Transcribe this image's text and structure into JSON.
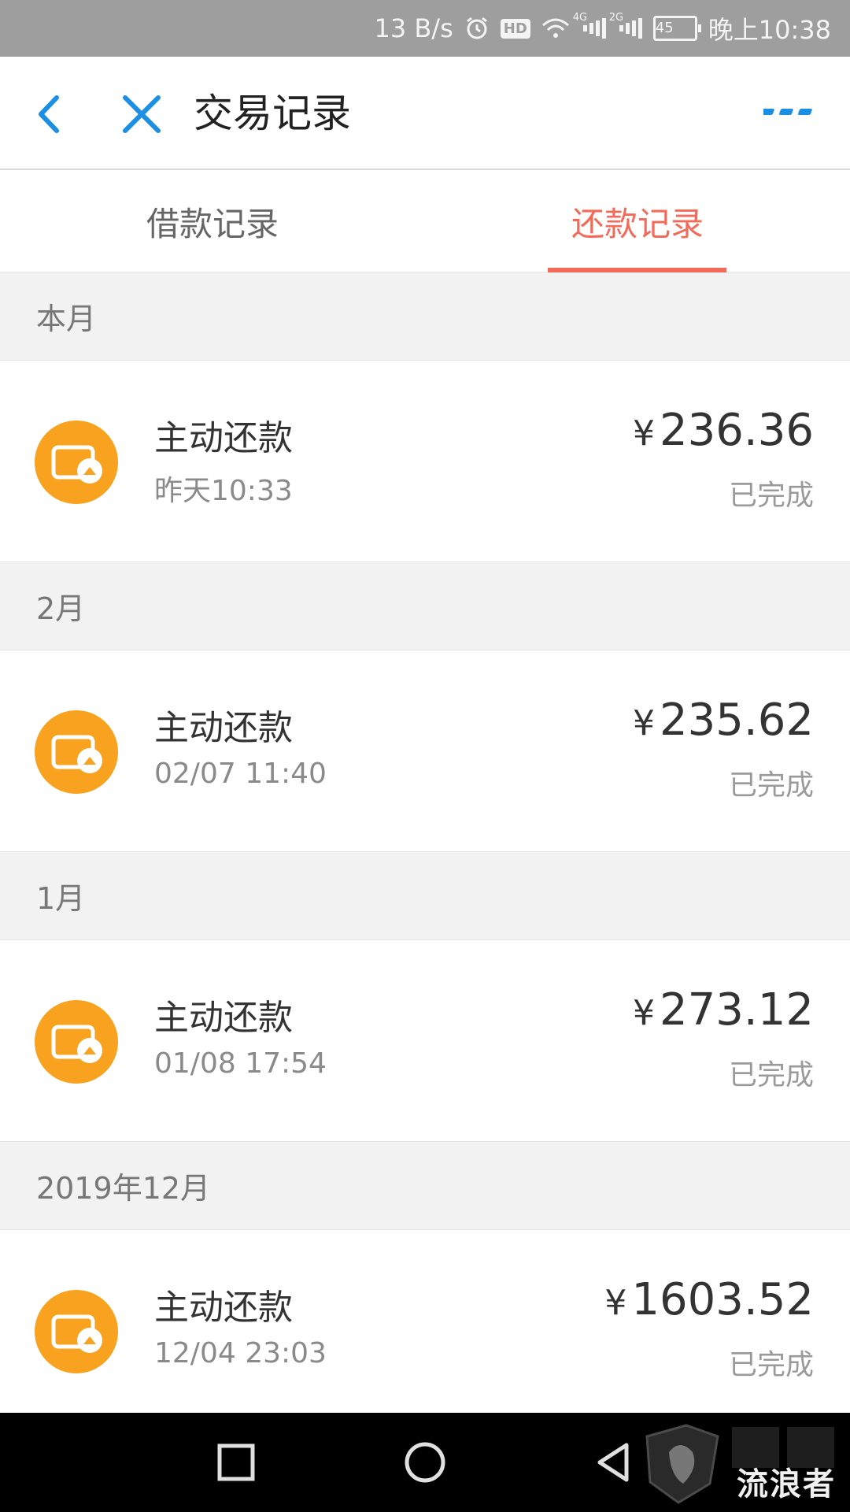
{
  "status_bar": {
    "speed": "13 B/s",
    "hd": "HD",
    "net_4g": "4G",
    "net_2g": "2G",
    "battery": "45",
    "time": "晚上10:38",
    "icons": [
      "alarm-icon",
      "hd-icon",
      "wifi-icon",
      "signal-icon",
      "battery-icon"
    ]
  },
  "header": {
    "title": "交易记录",
    "accent_color": "#1a8fe3"
  },
  "tabs": [
    {
      "label": "借款记录",
      "active": false
    },
    {
      "label": "还款记录",
      "active": true
    }
  ],
  "active_color": "#f26a5a",
  "sections": [
    {
      "month": "本月",
      "records": [
        {
          "title": "主动还款",
          "time": "昨天10:33",
          "currency": "¥",
          "amount": "236.36",
          "status": "已完成"
        }
      ]
    },
    {
      "month": "2月",
      "records": [
        {
          "title": "主动还款",
          "time": "02/07 11:40",
          "currency": "¥",
          "amount": "235.62",
          "status": "已完成"
        }
      ]
    },
    {
      "month": "1月",
      "records": [
        {
          "title": "主动还款",
          "time": "01/08 17:54",
          "currency": "¥",
          "amount": "273.12",
          "status": "已完成"
        }
      ]
    },
    {
      "month": "2019年12月",
      "records": [
        {
          "title": "主动还款",
          "time": "12/04 23:03",
          "currency": "¥",
          "amount": "1603.52",
          "status": "已完成"
        }
      ]
    }
  ],
  "record_icon": "wallet-repay-icon",
  "record_icon_color": "#f8a21f",
  "watermark": {
    "text": "流浪者"
  }
}
